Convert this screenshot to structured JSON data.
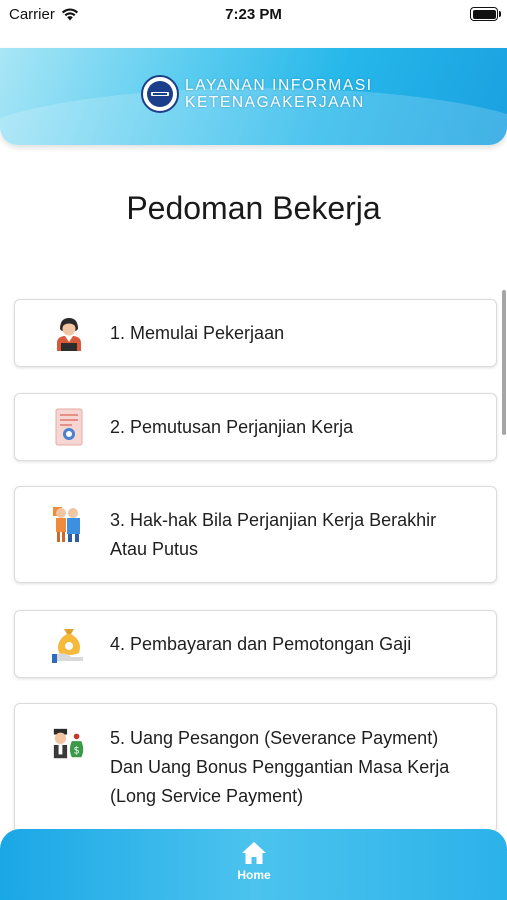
{
  "status_bar": {
    "carrier": "Carrier",
    "time": "7:23 PM"
  },
  "header": {
    "logo_line1": "LAYANAN INFORMASI",
    "logo_line2": "KETENAGAKERJAAN"
  },
  "page_title": "Pedoman Bekerja",
  "menu_items": [
    {
      "label": "1. Memulai Pekerjaan",
      "icon": "worker-icon"
    },
    {
      "label": "2. Pemutusan Perjanjian Kerja",
      "icon": "document-icon"
    },
    {
      "label": "3. Hak-hak Bila Perjanjian Kerja Berakhir Atau Putus",
      "icon": "people-icon"
    },
    {
      "label": "4. Pembayaran dan Pemotongan Gaji",
      "icon": "money-bag-icon"
    },
    {
      "label": "5. Uang Pesangon (Severance Payment) Dan Uang Bonus Penggantian Masa Kerja (Long Service Payment)",
      "icon": "severance-icon"
    }
  ],
  "bottom_nav": {
    "home_label": "Home"
  },
  "colors": {
    "accent": "#26b7ea",
    "text": "#1f1f1f"
  }
}
